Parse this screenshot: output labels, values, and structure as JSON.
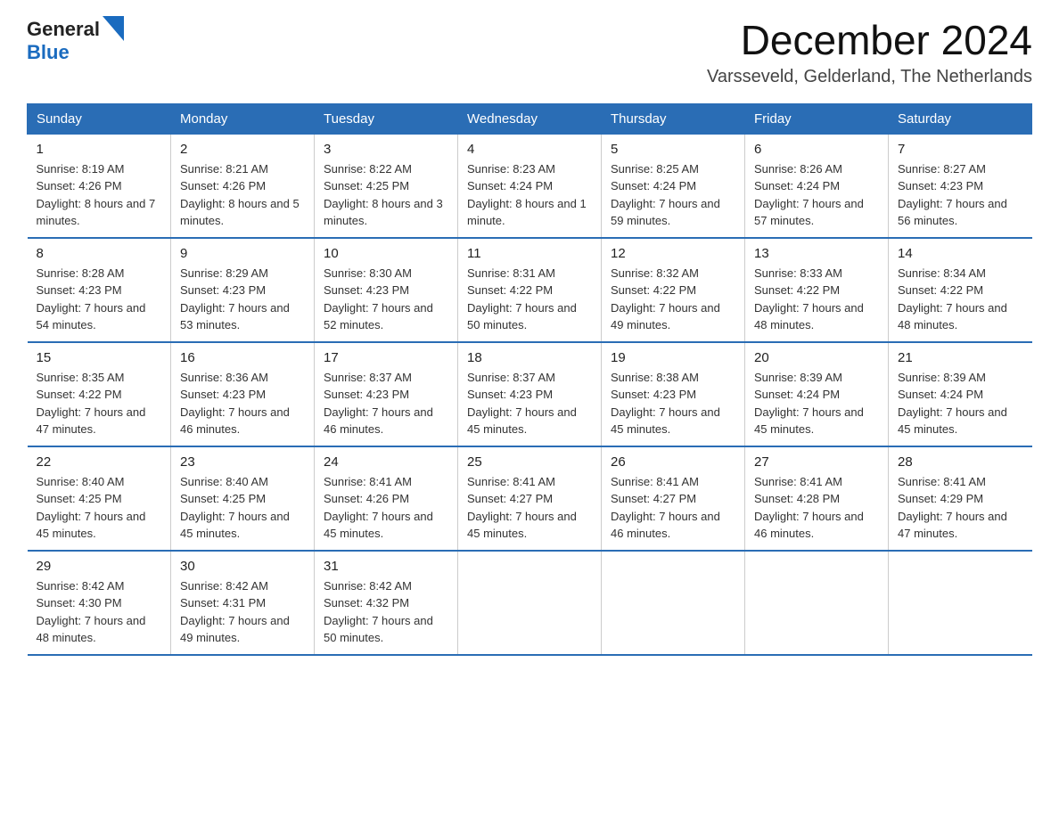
{
  "logo": {
    "general": "General",
    "blue": "Blue"
  },
  "title": {
    "month_year": "December 2024",
    "location": "Varsseveld, Gelderland, The Netherlands"
  },
  "days_of_week": [
    "Sunday",
    "Monday",
    "Tuesday",
    "Wednesday",
    "Thursday",
    "Friday",
    "Saturday"
  ],
  "weeks": [
    [
      {
        "day": "1",
        "sunrise": "8:19 AM",
        "sunset": "4:26 PM",
        "daylight": "8 hours and 7 minutes."
      },
      {
        "day": "2",
        "sunrise": "8:21 AM",
        "sunset": "4:26 PM",
        "daylight": "8 hours and 5 minutes."
      },
      {
        "day": "3",
        "sunrise": "8:22 AM",
        "sunset": "4:25 PM",
        "daylight": "8 hours and 3 minutes."
      },
      {
        "day": "4",
        "sunrise": "8:23 AM",
        "sunset": "4:24 PM",
        "daylight": "8 hours and 1 minute."
      },
      {
        "day": "5",
        "sunrise": "8:25 AM",
        "sunset": "4:24 PM",
        "daylight": "7 hours and 59 minutes."
      },
      {
        "day": "6",
        "sunrise": "8:26 AM",
        "sunset": "4:24 PM",
        "daylight": "7 hours and 57 minutes."
      },
      {
        "day": "7",
        "sunrise": "8:27 AM",
        "sunset": "4:23 PM",
        "daylight": "7 hours and 56 minutes."
      }
    ],
    [
      {
        "day": "8",
        "sunrise": "8:28 AM",
        "sunset": "4:23 PM",
        "daylight": "7 hours and 54 minutes."
      },
      {
        "day": "9",
        "sunrise": "8:29 AM",
        "sunset": "4:23 PM",
        "daylight": "7 hours and 53 minutes."
      },
      {
        "day": "10",
        "sunrise": "8:30 AM",
        "sunset": "4:23 PM",
        "daylight": "7 hours and 52 minutes."
      },
      {
        "day": "11",
        "sunrise": "8:31 AM",
        "sunset": "4:22 PM",
        "daylight": "7 hours and 50 minutes."
      },
      {
        "day": "12",
        "sunrise": "8:32 AM",
        "sunset": "4:22 PM",
        "daylight": "7 hours and 49 minutes."
      },
      {
        "day": "13",
        "sunrise": "8:33 AM",
        "sunset": "4:22 PM",
        "daylight": "7 hours and 48 minutes."
      },
      {
        "day": "14",
        "sunrise": "8:34 AM",
        "sunset": "4:22 PM",
        "daylight": "7 hours and 48 minutes."
      }
    ],
    [
      {
        "day": "15",
        "sunrise": "8:35 AM",
        "sunset": "4:22 PM",
        "daylight": "7 hours and 47 minutes."
      },
      {
        "day": "16",
        "sunrise": "8:36 AM",
        "sunset": "4:23 PM",
        "daylight": "7 hours and 46 minutes."
      },
      {
        "day": "17",
        "sunrise": "8:37 AM",
        "sunset": "4:23 PM",
        "daylight": "7 hours and 46 minutes."
      },
      {
        "day": "18",
        "sunrise": "8:37 AM",
        "sunset": "4:23 PM",
        "daylight": "7 hours and 45 minutes."
      },
      {
        "day": "19",
        "sunrise": "8:38 AM",
        "sunset": "4:23 PM",
        "daylight": "7 hours and 45 minutes."
      },
      {
        "day": "20",
        "sunrise": "8:39 AM",
        "sunset": "4:24 PM",
        "daylight": "7 hours and 45 minutes."
      },
      {
        "day": "21",
        "sunrise": "8:39 AM",
        "sunset": "4:24 PM",
        "daylight": "7 hours and 45 minutes."
      }
    ],
    [
      {
        "day": "22",
        "sunrise": "8:40 AM",
        "sunset": "4:25 PM",
        "daylight": "7 hours and 45 minutes."
      },
      {
        "day": "23",
        "sunrise": "8:40 AM",
        "sunset": "4:25 PM",
        "daylight": "7 hours and 45 minutes."
      },
      {
        "day": "24",
        "sunrise": "8:41 AM",
        "sunset": "4:26 PM",
        "daylight": "7 hours and 45 minutes."
      },
      {
        "day": "25",
        "sunrise": "8:41 AM",
        "sunset": "4:27 PM",
        "daylight": "7 hours and 45 minutes."
      },
      {
        "day": "26",
        "sunrise": "8:41 AM",
        "sunset": "4:27 PM",
        "daylight": "7 hours and 46 minutes."
      },
      {
        "day": "27",
        "sunrise": "8:41 AM",
        "sunset": "4:28 PM",
        "daylight": "7 hours and 46 minutes."
      },
      {
        "day": "28",
        "sunrise": "8:41 AM",
        "sunset": "4:29 PM",
        "daylight": "7 hours and 47 minutes."
      }
    ],
    [
      {
        "day": "29",
        "sunrise": "8:42 AM",
        "sunset": "4:30 PM",
        "daylight": "7 hours and 48 minutes."
      },
      {
        "day": "30",
        "sunrise": "8:42 AM",
        "sunset": "4:31 PM",
        "daylight": "7 hours and 49 minutes."
      },
      {
        "day": "31",
        "sunrise": "8:42 AM",
        "sunset": "4:32 PM",
        "daylight": "7 hours and 50 minutes."
      },
      null,
      null,
      null,
      null
    ]
  ]
}
